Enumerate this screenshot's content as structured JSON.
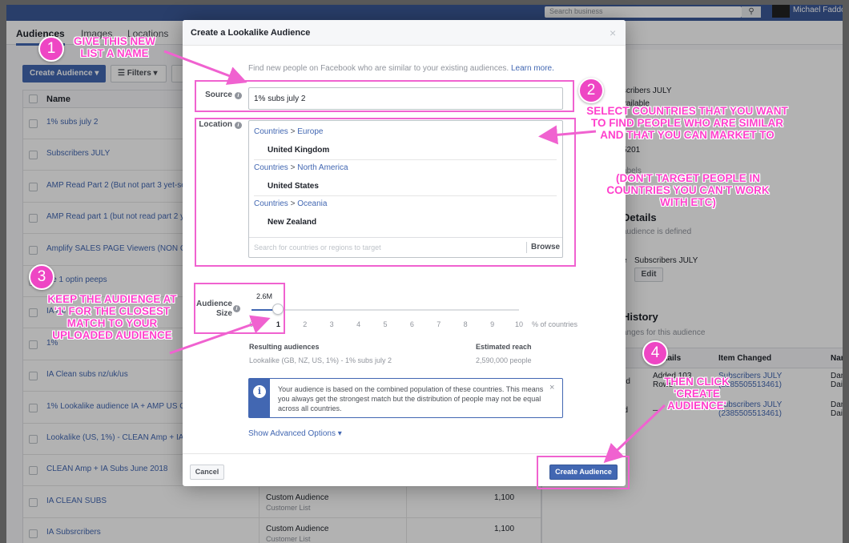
{
  "background": {
    "search_placeholder": "Search business",
    "user_name": "Michael Faddo",
    "tabs": [
      "Audiences",
      "Images",
      "Locations"
    ],
    "create_audience_button": "Create Audience ▾",
    "filters_button": "☰ Filters ▾",
    "table_header_name": "Name",
    "rows": [
      {
        "name": "1% subs july 2",
        "type": "",
        "sub": "",
        "size": ""
      },
      {
        "name": "Subscribers JULY",
        "type": "",
        "sub": "",
        "size": ""
      },
      {
        "name": "AMP Read Part 2 (But not part 3 yet-send t",
        "type": "",
        "sub": "",
        "size": ""
      },
      {
        "name": "AMP Read part 1 (but not read part 2 yet)",
        "type": "",
        "sub": "",
        "size": ""
      },
      {
        "name": "Amplify SALES PAGE Viewers (NON Custo",
        "type": "",
        "sub": "",
        "size": ""
      },
      {
        "name": "cle 1 optin peeps",
        "type": "",
        "sub": "",
        "size": ""
      },
      {
        "name": "IA Re",
        "type": "",
        "sub": "",
        "size": ""
      },
      {
        "name": "1%",
        "type": "",
        "sub": "",
        "size": ""
      },
      {
        "name": "IA Clean subs nz/uk/us",
        "type": "",
        "sub": "",
        "size": ""
      },
      {
        "name": "1% Lookalike audience IA + AMP US ONLY",
        "type": "",
        "sub": "",
        "size": ""
      },
      {
        "name": "Lookalike (US, 1%) - CLEAN Amp + IA Su",
        "type": "",
        "sub": "",
        "size": ""
      },
      {
        "name": "CLEAN Amp + IA Subs June 2018",
        "type": "",
        "sub": "",
        "size": ""
      },
      {
        "name": "IA CLEAN SUBS",
        "type": "Custom Audience",
        "sub": "Customer List",
        "size": "1,100"
      },
      {
        "name": "IA Subsrcribers",
        "type": "Custom Audience",
        "sub": "Customer List",
        "size": "1,100"
      }
    ],
    "right_panel": {
      "title_partial": "scribers JULY",
      "available": "vailable",
      "number_partial": "5201",
      "labels_partial": "abels",
      "details_heading": "Details",
      "defined_text": "audience is defined",
      "e_label": "e",
      "source_name": "Subscribers JULY",
      "edit_button": "Edit",
      "history_heading": "History",
      "history_sub": "anges for this audience",
      "col_details": "y Details",
      "col_item": "Item Changed",
      "col_name": "Name",
      "r1_action": "ted",
      "r1_details": "Added 103 Rows",
      "r1_item": "Subscribers JULY (2385505513461)",
      "r1_name": "Daniel Daines",
      "r2_action": "ed",
      "r2_details": "—",
      "r2_item": "Subscribers JULY (2385505513461)",
      "r2_name": "Daniel Daines"
    }
  },
  "modal": {
    "title": "Create a Lookalike Audience",
    "close": "×",
    "intro": "Find new people on Facebook who are similar to your existing audiences.",
    "learn_more": "Learn more.",
    "source_label": "Source",
    "source_value": "1% subs july 2",
    "location_label": "Location",
    "locations": [
      {
        "region": "Countries",
        "sep": " > ",
        "area": "Europe",
        "country": "United Kingdom"
      },
      {
        "region": "Countries",
        "sep": " > ",
        "area": "North America",
        "country": "United States"
      },
      {
        "region": "Countries",
        "sep": " > ",
        "area": "Oceania",
        "country": "New Zealand"
      }
    ],
    "location_search_placeholder": "Search for countries or regions to target",
    "browse": "Browse",
    "audience_size_label_1": "Audience",
    "audience_size_label_2": "Size",
    "audience_size_value": "2.6M",
    "slider_selected": 1,
    "slider_ticks": [
      "0",
      "1",
      "2",
      "3",
      "4",
      "5",
      "6",
      "7",
      "8",
      "9",
      "10"
    ],
    "percent_label": "% of countries",
    "resulting_heading": "Resulting audiences",
    "resulting_value": "Lookalike (GB, NZ, US, 1%) - 1% subs july 2",
    "reach_heading": "Estimated reach",
    "reach_value": "2,590,000 people",
    "notice": "Your audience is based on the combined population of these countries. This means you always get the strongest match but the distribution of people may not be equal across all countries.",
    "show_advanced": "Show Advanced Options ▾",
    "cancel": "Cancel",
    "create": "Create Audience"
  },
  "annotations": {
    "accent_color": "#ff3fcc",
    "badges": [
      "1",
      "2",
      "3",
      "4"
    ],
    "note1": "GIVE THIS NEW LIST A NAME",
    "note2a": "SELECT COUNTRIES THAT YOU WANT TO FIND PEOPLE WHO ARE SIMILAR AND THAT YOU CAN MARKET TO",
    "note2b": "(DON'T TARGET PEOPLE IN COUNTRIES YOU CAN'T WORK WITH ETC)",
    "note3": "KEEP THE AUDIENCE AT '1' FOR THE CLOSEST MATCH TO YOUR UPLOADED AUDIENCE",
    "note4": "THEN CLICK 'CREATE AUDIENCE'"
  }
}
